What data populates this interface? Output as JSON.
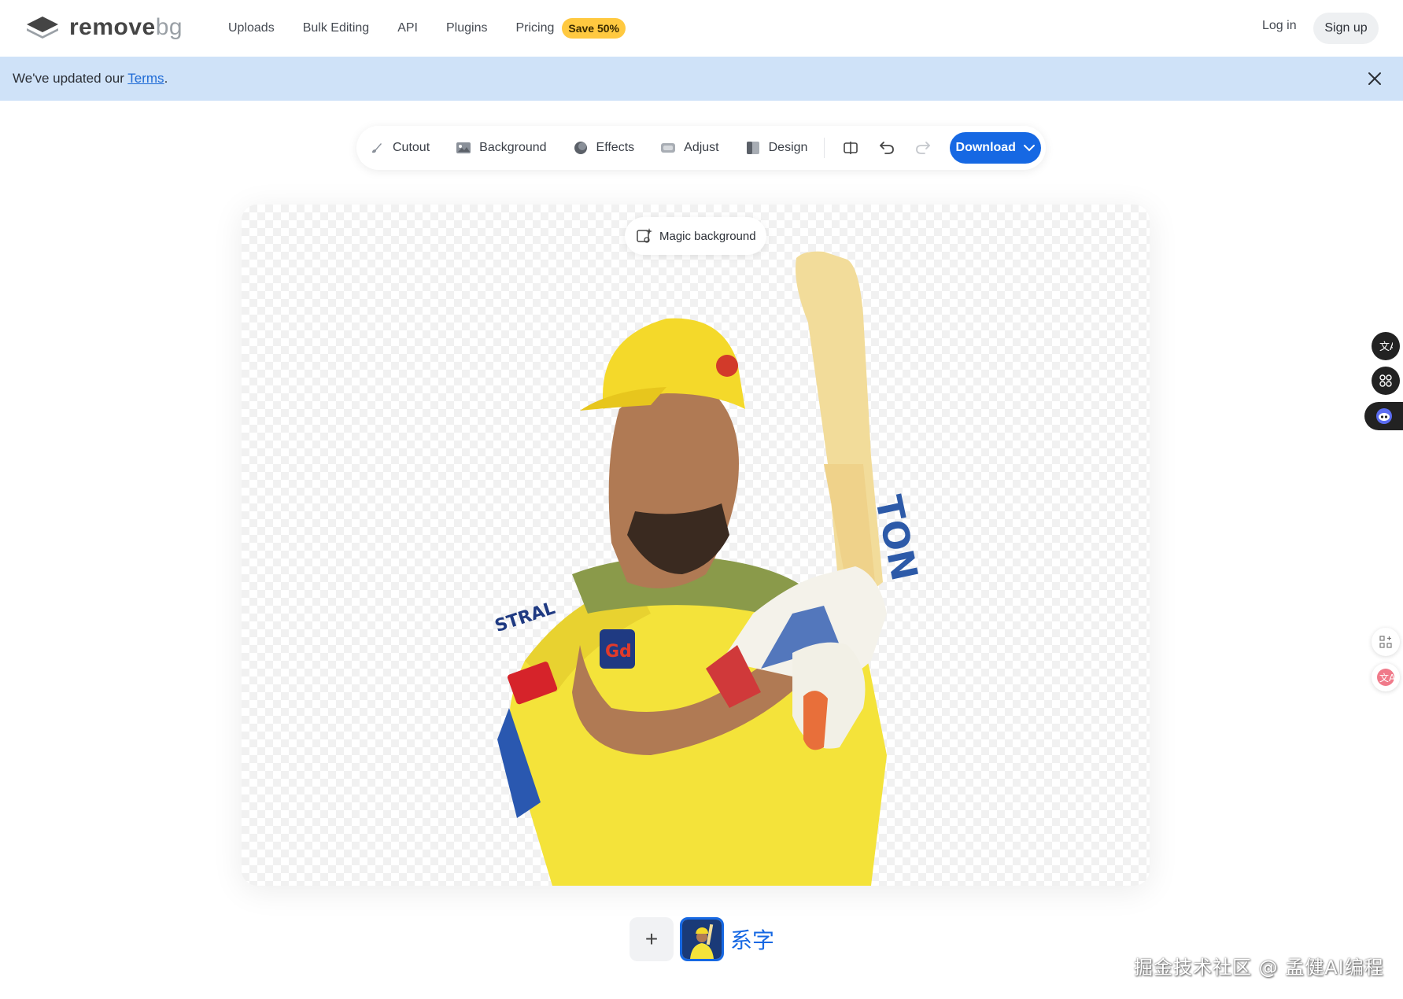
{
  "header": {
    "logo_main": "remove",
    "logo_suffix": "bg",
    "nav": [
      "Uploads",
      "Bulk Editing",
      "API",
      "Plugins",
      "Pricing"
    ],
    "save_badge": "Save 50%",
    "login": "Log in",
    "signup": "Sign up"
  },
  "banner": {
    "text_before": "We've updated our ",
    "link": "Terms",
    "text_after": "."
  },
  "toolbar": {
    "tools": [
      "Cutout",
      "Background",
      "Effects",
      "Adjust",
      "Design"
    ],
    "download": "Download"
  },
  "canvas": {
    "magic_background": "Magic background"
  },
  "thumbs": {
    "add": "+",
    "text_thumb": "系字"
  },
  "watermark": "掘金技术社区 @ 孟健AI编程",
  "colors": {
    "accent": "#1668e3",
    "banner": "#cfe2f8",
    "badge": "#ffc940"
  }
}
